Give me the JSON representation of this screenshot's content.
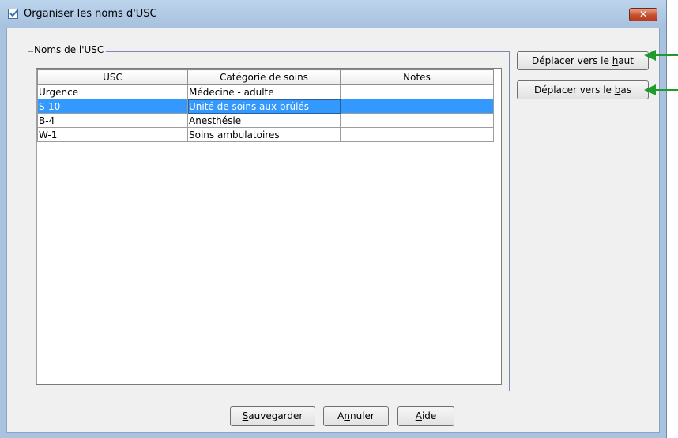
{
  "window": {
    "title": "Organiser les noms d'USC",
    "close_label": "✕"
  },
  "group": {
    "label": "Noms de l'USC"
  },
  "table": {
    "columns": [
      "USC",
      "Catégorie de soins",
      "Notes"
    ],
    "rows": [
      {
        "usc": "Urgence",
        "categorie": "Médecine - adulte",
        "notes": "",
        "selected": false
      },
      {
        "usc": "S-10",
        "categorie": "Unité de soins aux brûlés",
        "notes": "",
        "selected": true
      },
      {
        "usc": "B-4",
        "categorie": "Anesthésie",
        "notes": "",
        "selected": false
      },
      {
        "usc": "W-1",
        "categorie": "Soins ambulatoires",
        "notes": "",
        "selected": false
      }
    ]
  },
  "buttons": {
    "move_up": {
      "before": "Déplacer vers le ",
      "mnemonic": "h",
      "after": "aut"
    },
    "move_down": {
      "before": "Déplacer vers le ",
      "mnemonic": "b",
      "after": "as"
    },
    "save": {
      "before": "",
      "mnemonic": "S",
      "after": "auvegarder"
    },
    "cancel": {
      "before": "A",
      "mnemonic": "n",
      "after": "nuler"
    },
    "help": {
      "before": "",
      "mnemonic": "A",
      "after": "ide"
    }
  },
  "colors": {
    "selection": "#3399ff",
    "annotation_arrow": "#1e9a2e",
    "close_button": "#c7502f"
  },
  "icons": {
    "app": "checkbox-icon",
    "close": "close-icon",
    "annotation": "arrow-left-icon"
  }
}
